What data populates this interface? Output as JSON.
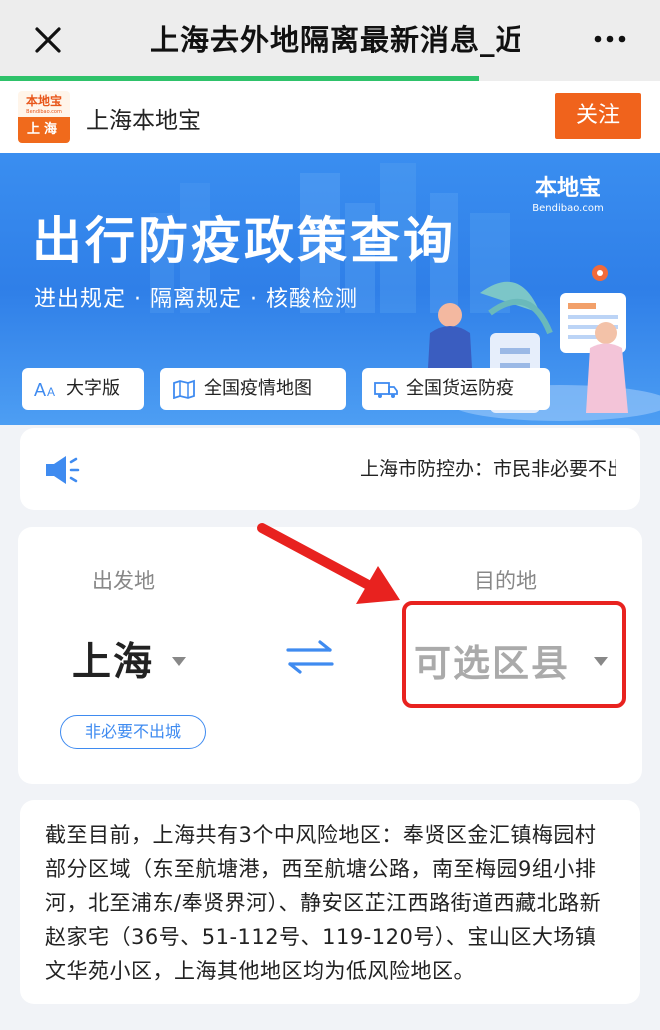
{
  "navbar": {
    "title": "上海去外地隔离最新消息_近",
    "progress_fraction": 0.725
  },
  "account": {
    "logo_top": "本地宝",
    "logo_sub": "Bendibao.com",
    "logo_bottom": "上海",
    "name": "上海本地宝",
    "follow_label": "关注"
  },
  "banner": {
    "title": "出行防疫政策查询",
    "subtitle": "进出规定 · 隔离规定 · 核酸检测",
    "logo_main": "本地宝",
    "logo_sub": "Bendibao.com",
    "pills": [
      {
        "label": "大字版",
        "icon": "font-size-icon"
      },
      {
        "label": "全国疫情地图",
        "icon": "map-icon"
      },
      {
        "label": "全国货运防疫",
        "icon": "truck-icon"
      }
    ]
  },
  "notice": {
    "text": "上海市防控办：市民非必要不出城"
  },
  "route": {
    "from_label": "出发地",
    "to_label": "目的地",
    "from_city": "上海",
    "to_city": "可选区县",
    "tag": "非必要不出城"
  },
  "info": {
    "text": "截至目前，上海共有3个中风险地区：奉贤区金汇镇梅园村部分区域（东至航塘港，西至航塘公路，南至梅园9组小排河，北至浦东/奉贤界河）、静安区芷江西路街道西藏北路新赵家宅（36号、51-112号、119-120号）、宝山区大场镇文华苑小区，上海其他地区均为低风险地区。"
  },
  "colors": {
    "accent_blue": "#3f8bf0",
    "follow_orange": "#f0631c",
    "progress_green": "#2ec26a",
    "annotation_red": "#e8221f"
  }
}
